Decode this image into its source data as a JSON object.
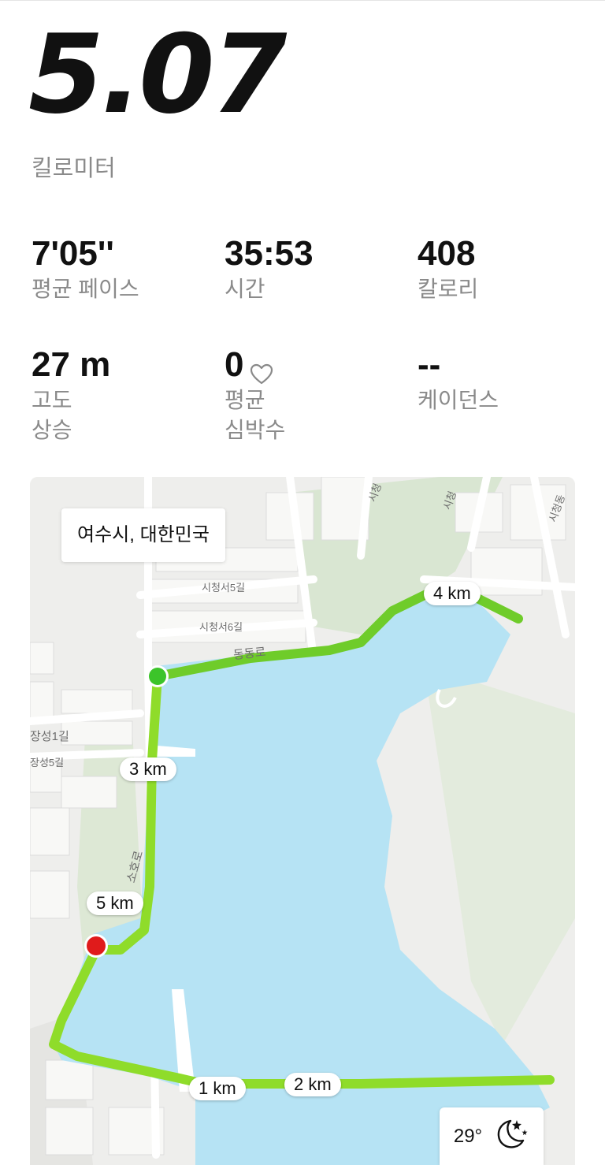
{
  "summary": {
    "distance": "5.07",
    "distance_unit": "킬로미터"
  },
  "stats": [
    {
      "value": "7'05''",
      "label": "평균 페이스"
    },
    {
      "value": "35:53",
      "label": "시간"
    },
    {
      "value": "408",
      "label": "칼로리"
    },
    {
      "value": "27 m",
      "label_line1": "고도",
      "label_line2": "상승"
    },
    {
      "value": "0",
      "label_line1": "평균",
      "label_line2": "심박수",
      "icon": "heart-outline-icon"
    },
    {
      "value": "--",
      "label": "케이던스"
    }
  ],
  "map": {
    "location": "여수시, 대한민국",
    "km_markers": [
      "1 km",
      "2 km",
      "3 km",
      "4 km",
      "5 km"
    ],
    "road_labels": [
      "시청서5길",
      "시청서6길",
      "동동로",
      "장성1길",
      "장성5길",
      "소호로",
      "시청",
      "시청",
      "시청동"
    ],
    "start_color": "#3cc42a",
    "end_color": "#e01b1b",
    "route_color": "#8fdc2a",
    "water_color": "#b6e3f4",
    "weather": {
      "temperature": "29°",
      "icon": "moon-stars-icon"
    }
  }
}
